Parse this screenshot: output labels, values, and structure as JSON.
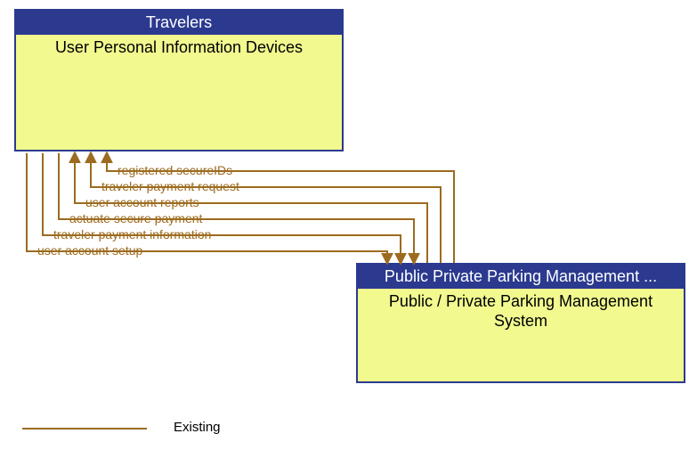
{
  "boxA": {
    "header": "Travelers",
    "body": "User Personal Information Devices"
  },
  "boxB": {
    "header": "Public Private Parking Management ...",
    "body": "Public / Private Parking Management System"
  },
  "flows": [
    {
      "label": "registered secureIDs"
    },
    {
      "label": "traveler payment request"
    },
    {
      "label": "user account reports"
    },
    {
      "label": "actuate secure payment"
    },
    {
      "label": "traveler payment information"
    },
    {
      "label": "user account setup"
    }
  ],
  "legend": {
    "existing": "Existing"
  }
}
